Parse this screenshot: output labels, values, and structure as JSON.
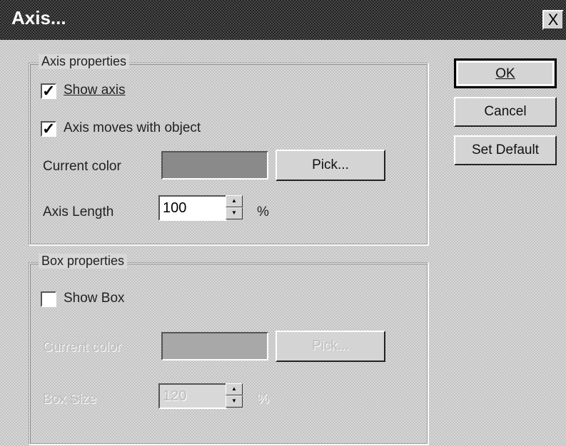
{
  "window": {
    "title": "Axis...",
    "close_glyph": "X"
  },
  "axis_properties": {
    "legend": "Axis properties",
    "show_axis": {
      "label": "Show axis",
      "checked": true
    },
    "axis_moves": {
      "label": "Axis moves with object",
      "checked": true
    },
    "current_color_label": "Current color",
    "color": "#8a8a8a",
    "pick_label": "Pick...",
    "axis_length_label": "Axis Length",
    "axis_length_value": "100",
    "percent": "%"
  },
  "box_properties": {
    "legend": "Box properties",
    "show_box": {
      "label": "Show Box",
      "checked": false
    },
    "current_color_label": "Current color",
    "color": "#a8a8a8",
    "pick_label": "Pick...",
    "box_size_label": "Box Size",
    "box_size_value": "120",
    "percent": "%"
  },
  "buttons": {
    "ok": "OK",
    "cancel": "Cancel",
    "set_default": "Set Default"
  },
  "icons": {
    "check": "✓",
    "spin_up": "▲",
    "spin_down": "▼"
  }
}
